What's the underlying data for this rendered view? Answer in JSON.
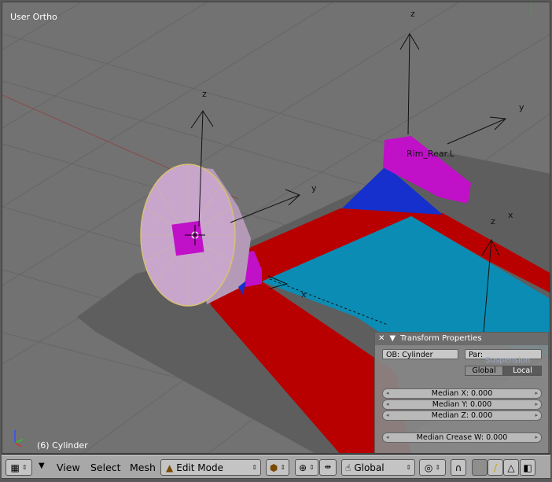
{
  "viewport": {
    "view_name": "User Ortho",
    "object_info": "(6) Cylinder",
    "bone_label": "Rim_Rear.L",
    "axis_labels": {
      "z1": "z",
      "y1": "y",
      "x1": "x",
      "z2": "z",
      "y2": "y",
      "z3": "z",
      "x3": "x"
    }
  },
  "transform_panel": {
    "title": "Transform Properties",
    "ob_label": "OB: Cylinder",
    "par_label": "Par:",
    "hidden_text": "Suspension",
    "global_label": "Global",
    "local_label": "Local",
    "median_x": "Median X: 0.000",
    "median_y": "Median Y: 0.000",
    "median_z": "Median Z: 0.000",
    "median_crease": "Median Crease W: 0.000"
  },
  "header": {
    "view_menu": "View",
    "select_menu": "Select",
    "mesh_menu": "Mesh",
    "mode_value": "Edit Mode",
    "orientation_value": "Global"
  },
  "colors": {
    "viewport_bg": "#727272",
    "grid": "#676767",
    "frame_red": "#b80000",
    "floor_blue": "#0b8cb4",
    "dark_blue": "#1530cc",
    "magenta": "#c010c8",
    "wheel": "#c8a6cc",
    "shadow": "#5e5e5e"
  }
}
